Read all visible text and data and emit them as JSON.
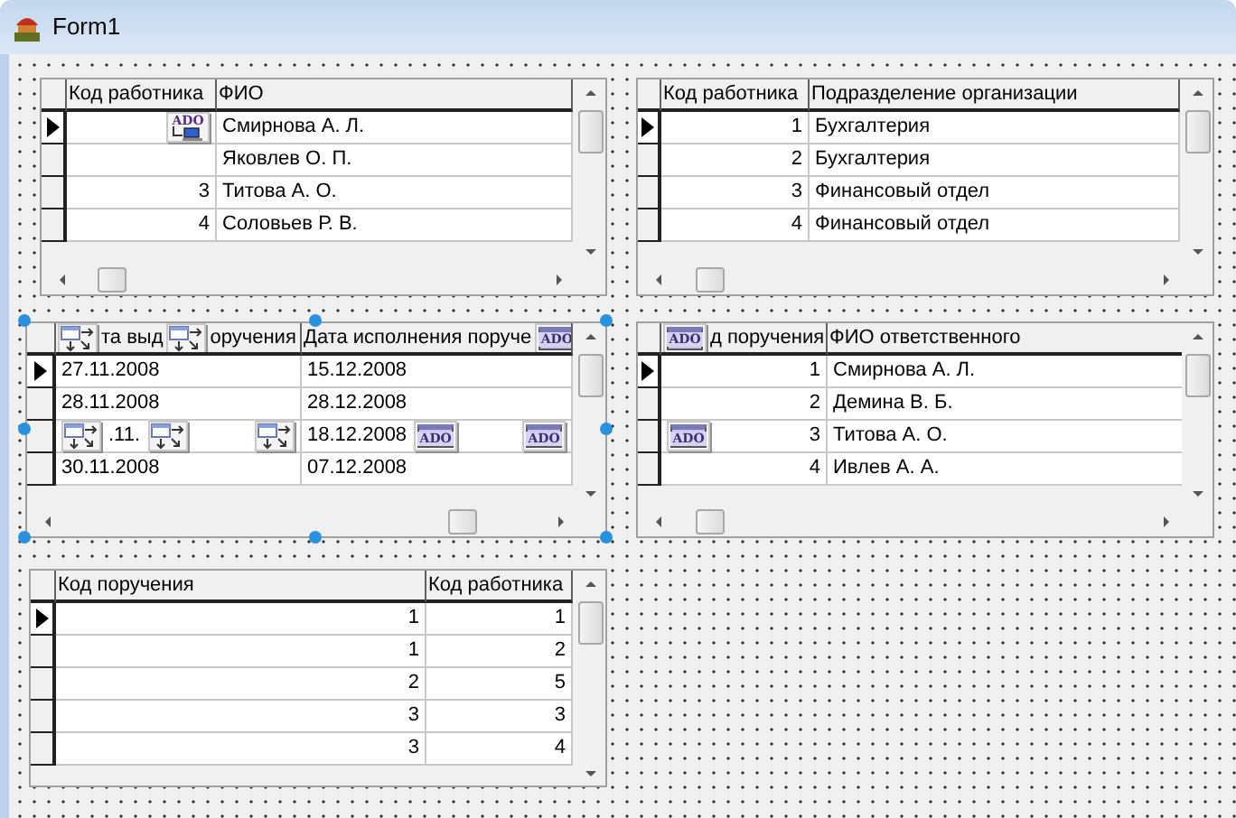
{
  "window": {
    "title": "Form1"
  },
  "grids": [
    {
      "columns": [
        {
          "kind": "number",
          "title": "Код работника"
        },
        {
          "kind": "text",
          "title": "ФИО"
        }
      ],
      "hscroll": true,
      "selected": false,
      "rows": [
        {
          "current": true,
          "cells": [
            [
              {
                "kind": "connection",
                "label": "ADO"
              }
            ],
            "Смирнова А. Л."
          ]
        },
        {
          "current": false,
          "cells": [
            "",
            "Яковлев О. П."
          ]
        },
        {
          "current": false,
          "cells": [
            "3",
            "Титова А. О."
          ]
        },
        {
          "current": false,
          "cells": [
            "4",
            "Соловьев Р. В."
          ]
        }
      ]
    },
    {
      "columns": [
        {
          "kind": "number",
          "title": "Код работника"
        },
        {
          "kind": "text",
          "title": "Подразделение организации"
        }
      ],
      "hscroll": true,
      "selected": false,
      "rows": [
        {
          "current": true,
          "cells": [
            "1",
            "Бухгалтерия"
          ]
        },
        {
          "current": false,
          "cells": [
            "2",
            "Бухгалтерия"
          ]
        },
        {
          "current": false,
          "cells": [
            "3",
            "Финансовый отдел"
          ]
        },
        {
          "current": false,
          "cells": [
            "4",
            "Финансовый отдел"
          ]
        }
      ]
    },
    {
      "columns": [
        {
          "kind": "text",
          "title": [
            {
              "kind": "datasource"
            },
            {
              "kind": "text",
              "text": "та выд"
            },
            {
              "kind": "datasource"
            },
            {
              "kind": "text",
              "text": "оручения"
            }
          ]
        },
        {
          "kind": "text",
          "title": [
            {
              "kind": "text",
              "text": "Дата исполнения поруче"
            },
            {
              "kind": "table",
              "label": "ADO"
            }
          ]
        }
      ],
      "hscroll": true,
      "selected": true,
      "rows": [
        {
          "current": true,
          "cells": [
            "27.11.2008",
            "15.12.2008"
          ]
        },
        {
          "current": false,
          "cells": [
            "28.11.2008",
            "28.12.2008"
          ]
        },
        {
          "current": false,
          "cells": [
            [
              {
                "kind": "datasource"
              },
              {
                "kind": "text",
                "text": ".11."
              },
              {
                "kind": "datasource"
              },
              {
                "kind": "datasource"
              }
            ],
            [
              {
                "kind": "text",
                "text": "18.12.2008"
              },
              {
                "kind": "table",
                "label": "ADO"
              },
              {
                "kind": "table",
                "label": "ADO"
              }
            ]
          ]
        },
        {
          "current": false,
          "cells": [
            "30.11.2008",
            "07.12.2008"
          ]
        }
      ]
    },
    {
      "columns": [
        {
          "kind": "number",
          "title": [
            {
              "kind": "table",
              "label": "ADO"
            },
            {
              "kind": "text",
              "text": "д поручения"
            }
          ]
        },
        {
          "kind": "text",
          "title": "ФИО ответственного"
        }
      ],
      "hscroll": true,
      "selected": false,
      "rows": [
        {
          "current": true,
          "cells": [
            "1",
            "Смирнова А. Л."
          ]
        },
        {
          "current": false,
          "cells": [
            "2",
            "Демина В. Б."
          ]
        },
        {
          "current": false,
          "cells": [
            [
              {
                "kind": "table",
                "label": "ADO"
              },
              {
                "kind": "text",
                "text": "3"
              }
            ],
            "Титова А. О."
          ]
        },
        {
          "current": false,
          "cells": [
            "4",
            "Ивлев А. А."
          ]
        }
      ]
    },
    {
      "columns": [
        {
          "kind": "number",
          "title": "Код поручения"
        },
        {
          "kind": "number",
          "title": "Код работника"
        }
      ],
      "hscroll": false,
      "selected": false,
      "rows": [
        {
          "current": true,
          "cells": [
            "1",
            "1"
          ]
        },
        {
          "current": false,
          "cells": [
            "1",
            "2"
          ]
        },
        {
          "current": false,
          "cells": [
            "2",
            "5"
          ]
        },
        {
          "current": false,
          "cells": [
            "3",
            "3"
          ]
        },
        {
          "current": false,
          "cells": [
            "3",
            "4"
          ]
        }
      ]
    }
  ]
}
